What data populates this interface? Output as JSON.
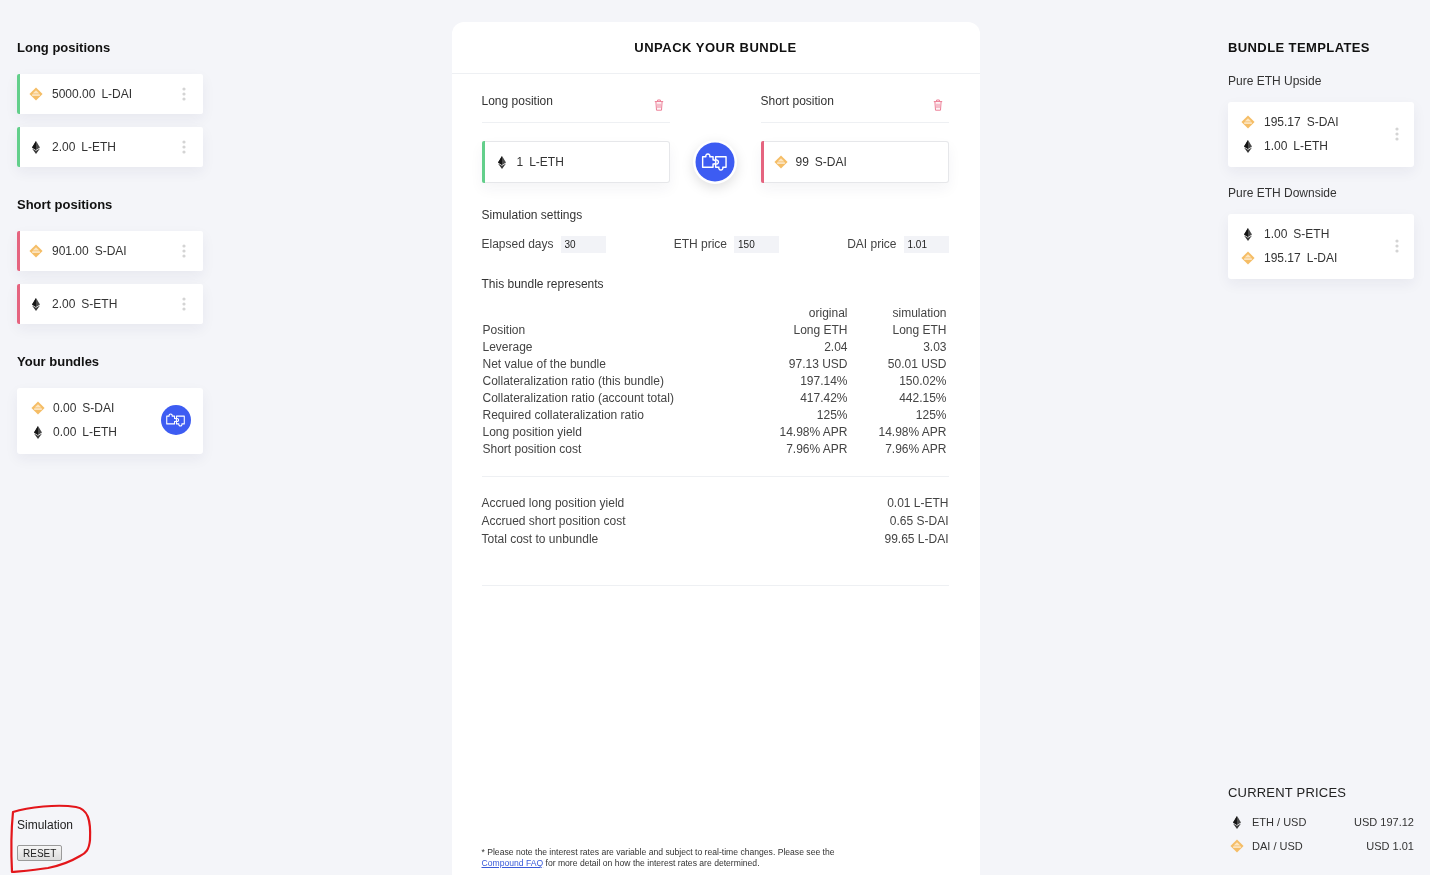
{
  "left": {
    "long_positions": {
      "title": "Long positions",
      "items": [
        {
          "kind": "dai",
          "amount": "5000.00",
          "symbol": "L-DAI",
          "color": "#63cf8b"
        },
        {
          "kind": "eth",
          "amount": "2.00",
          "symbol": "L-ETH",
          "color": "#63cf8b"
        }
      ]
    },
    "short_positions": {
      "title": "Short positions",
      "items": [
        {
          "kind": "dai",
          "amount": "901.00",
          "symbol": "S-DAI",
          "color": "#e5647f"
        },
        {
          "kind": "eth",
          "amount": "2.00",
          "symbol": "S-ETH",
          "color": "#e5647f"
        }
      ]
    },
    "bundles": {
      "title": "Your bundles",
      "items": [
        {
          "assets": [
            {
              "kind": "dai",
              "amount": "0.00",
              "symbol": "S-DAI"
            },
            {
              "kind": "eth",
              "amount": "0.00",
              "symbol": "L-ETH"
            }
          ]
        }
      ]
    },
    "simulation": {
      "title": "Simulation",
      "button": "RESET"
    }
  },
  "unpack": {
    "title": "UNPACK YOUR BUNDLE",
    "legs": [
      {
        "label": "Long position",
        "color": "#63cf8b",
        "kind": "eth",
        "amount": "1",
        "symbol": "L-ETH"
      },
      {
        "label": "Short position",
        "color": "#e5647f",
        "kind": "dai",
        "amount": "99",
        "symbol": "S-DAI"
      }
    ],
    "settings": {
      "title": "Simulation settings",
      "fields": [
        {
          "label": "Elapsed days",
          "value": "30"
        },
        {
          "label": "ETH price",
          "value": "150"
        },
        {
          "label": "DAI price",
          "value": "1.01"
        }
      ]
    },
    "summary": {
      "title": "This bundle represents",
      "columns": [
        "original",
        "simulation"
      ],
      "rows": [
        {
          "label": "Position",
          "values": [
            "Long ETH",
            "Long ETH"
          ]
        },
        {
          "label": "Leverage",
          "values": [
            "2.04",
            "3.03"
          ]
        },
        {
          "label": "Net value of the bundle",
          "values": [
            "97.13 USD",
            "50.01 USD"
          ]
        },
        {
          "label": "Collateralization ratio (this bundle)",
          "values": [
            "197.14%",
            "150.02%"
          ]
        },
        {
          "label": "Collateralization ratio (account total)",
          "values": [
            "417.42%",
            "442.15%"
          ]
        },
        {
          "label": "Required collateralization ratio",
          "values": [
            "125%",
            "125%"
          ]
        },
        {
          "label": "Long position yield",
          "values": [
            "14.98% APR",
            "14.98% APR"
          ]
        },
        {
          "label": "Short position cost",
          "values": [
            "7.96% APR",
            "7.96% APR"
          ]
        }
      ]
    },
    "costs": [
      {
        "label": "Accrued long position yield",
        "value": "0.01 L-ETH"
      },
      {
        "label": "Accrued short position cost",
        "value": "0.65 S-DAI"
      },
      {
        "label": "Total cost to unbundle",
        "value": "99.65 L-DAI"
      }
    ],
    "footnote": {
      "before": "* Please note the interest rates are variable and subject to real-time changes. Please see the",
      "link": "Compound FAQ",
      "after": "for more detail on how the interest rates are determined."
    }
  },
  "right": {
    "templates": {
      "title": "BUNDLE TEMPLATES",
      "items": [
        {
          "name": "Pure ETH Upside",
          "assets": [
            {
              "kind": "dai",
              "amount": "195.17",
              "symbol": "S-DAI"
            },
            {
              "kind": "eth",
              "amount": "1.00",
              "symbol": "L-ETH"
            }
          ]
        },
        {
          "name": "Pure ETH Downside",
          "assets": [
            {
              "kind": "eth",
              "amount": "1.00",
              "symbol": "S-ETH"
            },
            {
              "kind": "dai",
              "amount": "195.17",
              "symbol": "L-DAI"
            }
          ]
        }
      ]
    },
    "prices": {
      "title": "CURRENT PRICES",
      "items": [
        {
          "kind": "eth",
          "pair": "ETH / USD",
          "value": "USD 197.12"
        },
        {
          "kind": "dai",
          "pair": "DAI / USD",
          "value": "USD 1.01"
        }
      ]
    }
  }
}
